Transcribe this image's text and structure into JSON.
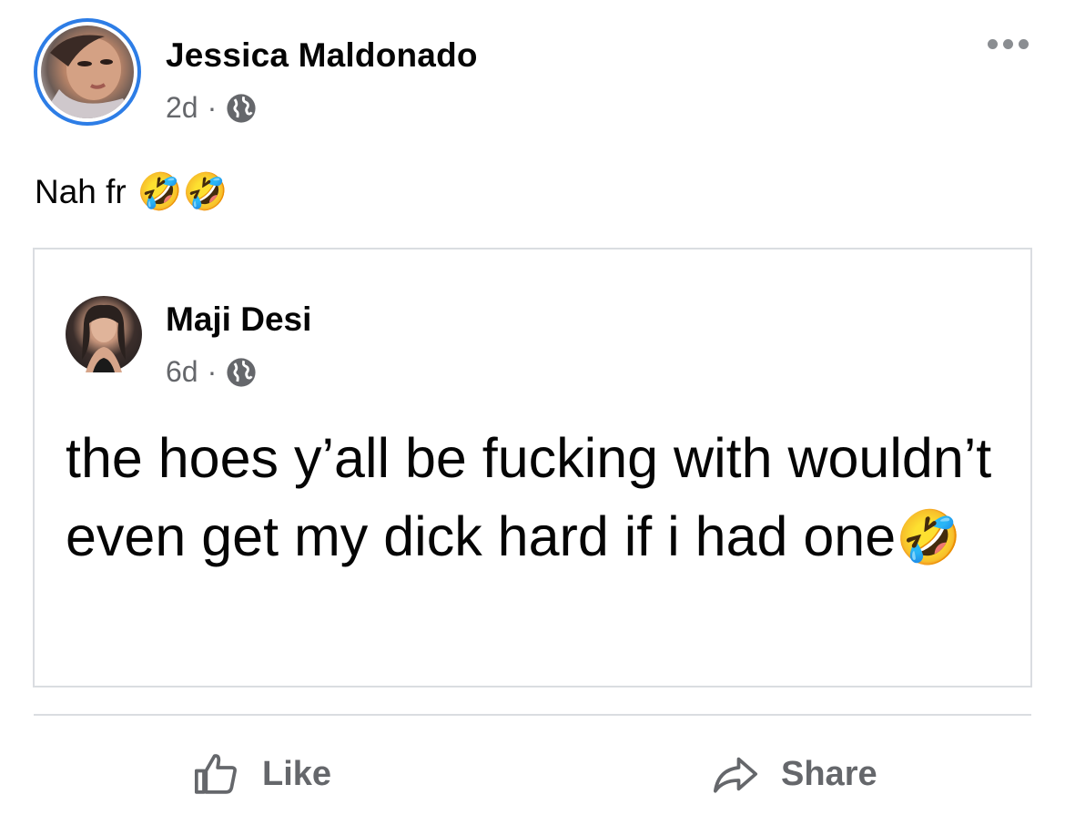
{
  "post": {
    "author": "Jessica Maldonado",
    "time": "2d",
    "separator": "·",
    "text": "Nah fr",
    "emoji": "🤣🤣",
    "icons": {
      "privacy": "globe-icon",
      "more": "more-options-icon"
    }
  },
  "shared": {
    "author": "Maji Desi",
    "time": "6d",
    "separator": "·",
    "text": "the hoes y’all be fucking with wouldn’t even get my dick hard if i had one",
    "emoji": "🤣",
    "icons": {
      "privacy": "globe-icon"
    }
  },
  "actions": {
    "like": {
      "label": "Like",
      "icon": "thumbs-up-icon"
    },
    "share": {
      "label": "Share",
      "icon": "share-arrow-icon"
    }
  },
  "colors": {
    "accent_ring": "#2d7de6",
    "meta_gray": "#65676b",
    "divider": "#dadde1"
  }
}
